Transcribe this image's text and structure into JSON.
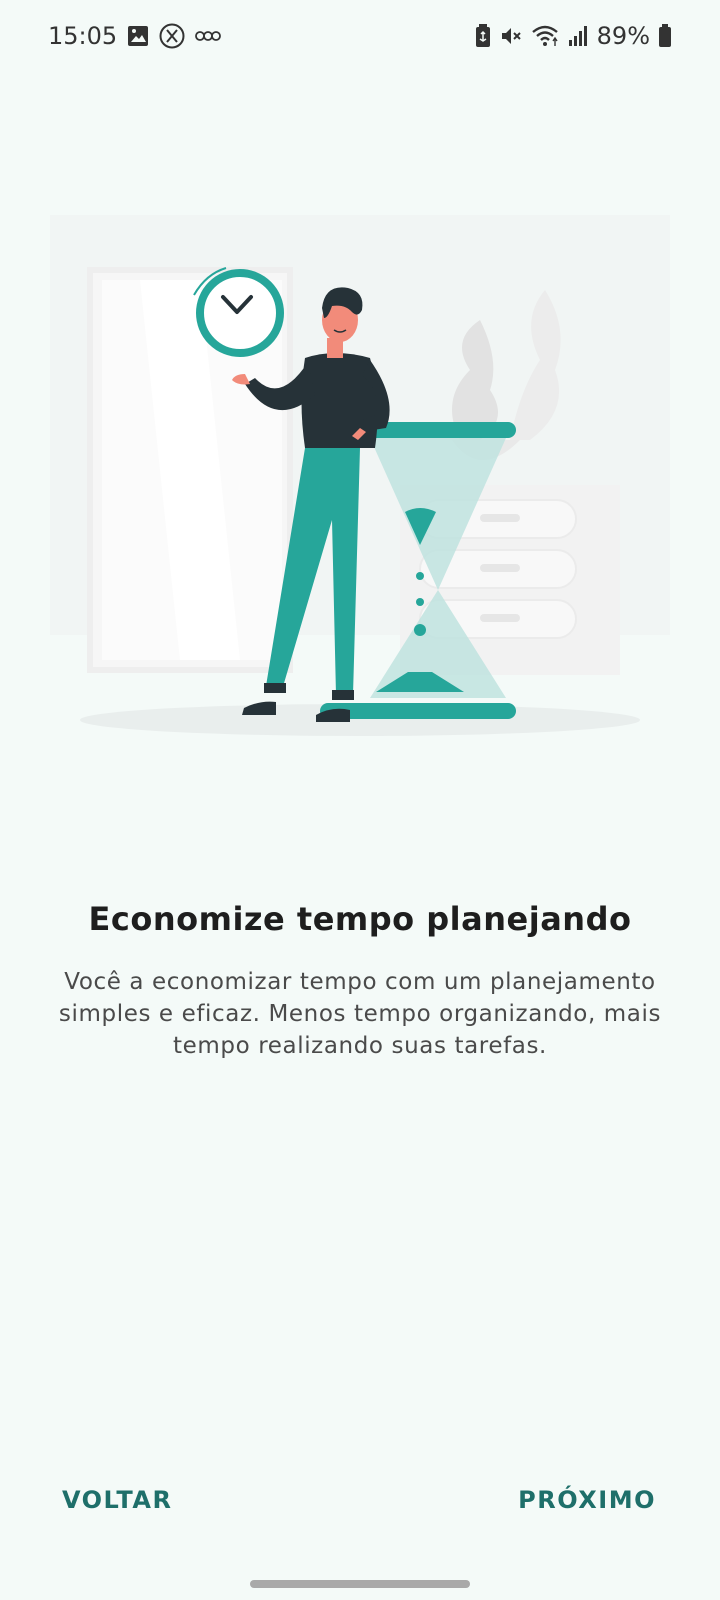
{
  "status_bar": {
    "time": "15:05",
    "battery": "89%",
    "icons_left": [
      "gallery-icon",
      "x-app-icon",
      "sketchbook-icon"
    ],
    "icons_right": [
      "battery-saver-icon",
      "mute-icon",
      "wifi-icon",
      "signal-icon",
      "battery-icon"
    ]
  },
  "onboarding": {
    "title": "Economize tempo planejando",
    "description": "Você a economizar tempo com um planejamento simples e eficaz. Menos tempo organizando, mais tempo realizando suas tarefas."
  },
  "navigation": {
    "back_label": "VOLTAR",
    "next_label": "PRÓXIMO"
  },
  "colors": {
    "accent": "#26a69a",
    "button_text": "#1e6f6a",
    "background": "#f4faf8"
  }
}
